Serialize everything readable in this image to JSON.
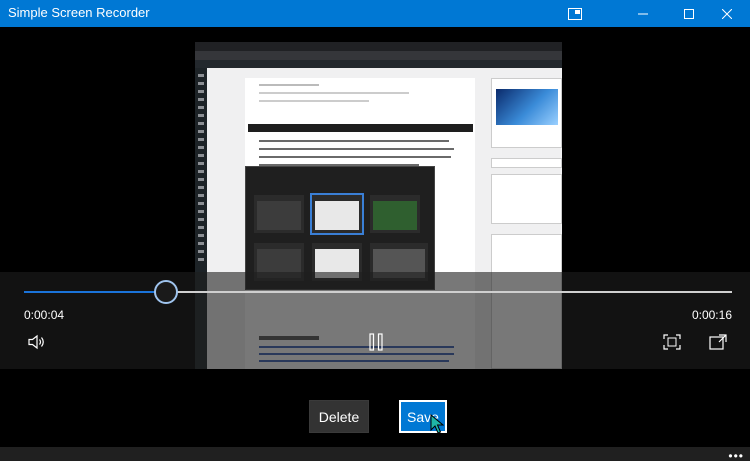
{
  "window": {
    "title": "Simple Screen Recorder"
  },
  "player": {
    "current_time": "0:00:04",
    "total_time": "0:00:16",
    "progress_fraction": 0.2
  },
  "actions": {
    "delete_label": "Delete",
    "save_label": "Save"
  },
  "icons": {
    "pip": "picture-in-picture-icon",
    "minimize": "minimize-icon",
    "maximize": "maximize-icon",
    "close": "close-icon",
    "volume": "volume-icon",
    "pause": "pause-icon",
    "aspect": "aspect-ratio-icon",
    "expand": "expand-icon",
    "more": "more-icon"
  },
  "colors": {
    "accent": "#0078d4",
    "progress": "#1a73d9"
  }
}
